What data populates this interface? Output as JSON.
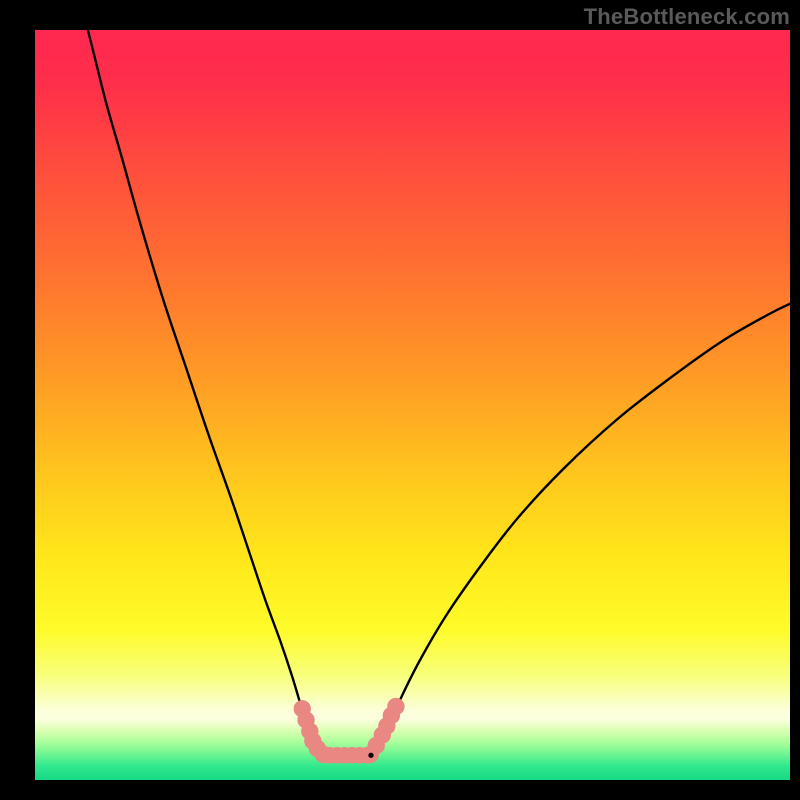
{
  "watermark": "TheBottleneck.com",
  "chart_data": {
    "type": "line",
    "title": "",
    "xlabel": "",
    "ylabel": "",
    "xlim": [
      0,
      100
    ],
    "ylim": [
      0,
      100
    ],
    "grid": false,
    "background": {
      "stops": [
        {
          "offset": 0.0,
          "color": "#ff2850"
        },
        {
          "offset": 0.07,
          "color": "#ff2e4a"
        },
        {
          "offset": 0.18,
          "color": "#ff4c3e"
        },
        {
          "offset": 0.3,
          "color": "#ff6b32"
        },
        {
          "offset": 0.45,
          "color": "#ff9726"
        },
        {
          "offset": 0.58,
          "color": "#ffc21e"
        },
        {
          "offset": 0.7,
          "color": "#ffe61a"
        },
        {
          "offset": 0.8,
          "color": "#fffb2a"
        },
        {
          "offset": 0.86,
          "color": "#f7ff7a"
        },
        {
          "offset": 0.905,
          "color": "#fbffd6"
        },
        {
          "offset": 0.918,
          "color": "#fdffe0"
        },
        {
          "offset": 0.935,
          "color": "#d8ffb0"
        },
        {
          "offset": 0.95,
          "color": "#a8ff9a"
        },
        {
          "offset": 0.965,
          "color": "#70f592"
        },
        {
          "offset": 0.982,
          "color": "#2fe88d"
        },
        {
          "offset": 1.0,
          "color": "#17d884"
        }
      ]
    },
    "series": [
      {
        "name": "curve-left",
        "points": [
          {
            "x": 7.0,
            "y": 100.0
          },
          {
            "x": 8.0,
            "y": 96.0
          },
          {
            "x": 9.5,
            "y": 90.0
          },
          {
            "x": 11.5,
            "y": 83.0
          },
          {
            "x": 14.0,
            "y": 74.0
          },
          {
            "x": 17.0,
            "y": 64.0
          },
          {
            "x": 20.0,
            "y": 55.0
          },
          {
            "x": 23.0,
            "y": 46.0
          },
          {
            "x": 26.0,
            "y": 37.5
          },
          {
            "x": 28.5,
            "y": 30.0
          },
          {
            "x": 30.5,
            "y": 24.0
          },
          {
            "x": 32.5,
            "y": 18.5
          },
          {
            "x": 34.0,
            "y": 14.0
          },
          {
            "x": 35.2,
            "y": 10.0
          },
          {
            "x": 36.0,
            "y": 7.5
          }
        ]
      },
      {
        "name": "curve-right",
        "points": [
          {
            "x": 47.0,
            "y": 7.5
          },
          {
            "x": 48.5,
            "y": 11.0
          },
          {
            "x": 51.0,
            "y": 16.0
          },
          {
            "x": 54.5,
            "y": 22.0
          },
          {
            "x": 59.0,
            "y": 28.5
          },
          {
            "x": 64.0,
            "y": 35.0
          },
          {
            "x": 70.0,
            "y": 41.5
          },
          {
            "x": 77.0,
            "y": 48.0
          },
          {
            "x": 84.0,
            "y": 53.5
          },
          {
            "x": 91.0,
            "y": 58.5
          },
          {
            "x": 97.0,
            "y": 62.0
          },
          {
            "x": 100.0,
            "y": 63.5
          }
        ]
      },
      {
        "name": "trough-line",
        "y": 3.3,
        "points": [
          {
            "x": 38.0,
            "y": 3.3
          },
          {
            "x": 44.5,
            "y": 3.3
          }
        ]
      }
    ],
    "marker_clusters": [
      {
        "name": "left-highlight",
        "color": "#e98883",
        "radius_pct": 1.15,
        "points": [
          {
            "x": 35.4,
            "y": 9.5
          },
          {
            "x": 35.9,
            "y": 8.0
          },
          {
            "x": 36.4,
            "y": 6.5
          },
          {
            "x": 36.8,
            "y": 5.2
          },
          {
            "x": 37.4,
            "y": 4.2
          },
          {
            "x": 38.2,
            "y": 3.4
          }
        ]
      },
      {
        "name": "right-highlight",
        "color": "#e98883",
        "radius_pct": 1.15,
        "points": [
          {
            "x": 44.4,
            "y": 3.4
          },
          {
            "x": 45.2,
            "y": 4.6
          },
          {
            "x": 46.0,
            "y": 6.0
          },
          {
            "x": 46.6,
            "y": 7.2
          },
          {
            "x": 47.2,
            "y": 8.6
          },
          {
            "x": 47.8,
            "y": 9.8
          }
        ]
      },
      {
        "name": "trough-fill",
        "color": "#e98883",
        "radius_pct": 1.1,
        "points": [
          {
            "x": 39.0,
            "y": 3.3
          },
          {
            "x": 40.0,
            "y": 3.3
          },
          {
            "x": 41.0,
            "y": 3.3
          },
          {
            "x": 42.0,
            "y": 3.3
          },
          {
            "x": 43.0,
            "y": 3.3
          },
          {
            "x": 44.0,
            "y": 3.3
          }
        ]
      },
      {
        "name": "trough-dot",
        "color": "#000000",
        "radius_pct": 0.35,
        "points": [
          {
            "x": 44.5,
            "y": 3.3
          }
        ]
      }
    ]
  }
}
